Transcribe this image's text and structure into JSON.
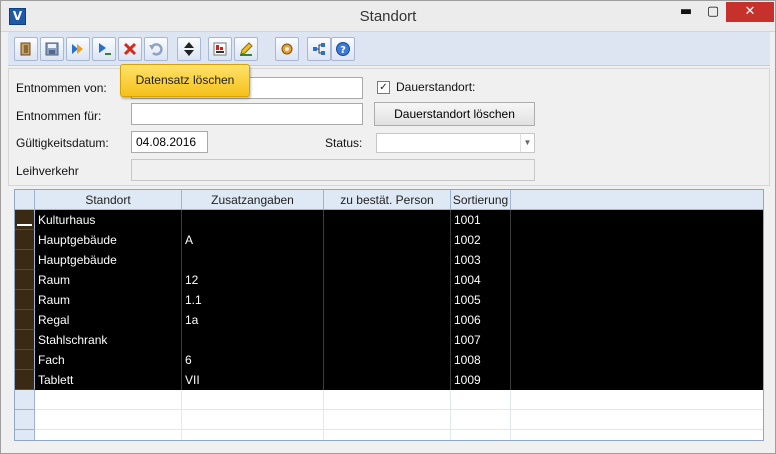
{
  "window": {
    "title": "Standort",
    "minimize": "▬",
    "maximize": "▢",
    "close": "✕"
  },
  "toolbar": {
    "buttons": [
      "exit-icon",
      "save-icon",
      "next-record-icon",
      "last-record-icon",
      "delete-icon",
      "undo-icon",
      "move-up-down-icon",
      "report-icon",
      "edit-icon",
      "settings-icon",
      "tree-icon",
      "help-icon"
    ]
  },
  "tooltip": {
    "text": "Datensatz löschen"
  },
  "form": {
    "entnommen_von_label": "Entnommen von:",
    "entnommen_von_value": "",
    "entnommen_fuer_label": "Entnommen für:",
    "entnommen_fuer_value": "",
    "dauerstandort_label": "Dauerstandort:",
    "dauerstandort_checked": true,
    "dauerstandort_loeschen": "Dauerstandort löschen",
    "gueltigkeitsdatum_label": "Gültigkeitsdatum:",
    "gueltigkeitsdatum_value": "04.08.2016",
    "status_label": "Status:",
    "status_value": "",
    "leihverkehr_label": "Leihverkehr",
    "leihverkehr_value": ""
  },
  "grid": {
    "columns": [
      "Standort",
      "Zusatzangaben",
      "zu bestät. Person",
      "Sortierung"
    ],
    "rows": [
      {
        "standort": "Kulturhaus",
        "zusatz": "",
        "person": "",
        "sort": "1001"
      },
      {
        "standort": "Hauptgebäude",
        "zusatz": "A",
        "person": "",
        "sort": "1002"
      },
      {
        "standort": "Hauptgebäude",
        "zusatz": "",
        "person": "",
        "sort": "1003"
      },
      {
        "standort": "Raum",
        "zusatz": "12",
        "person": "",
        "sort": "1004"
      },
      {
        "standort": "Raum",
        "zusatz": "1.1",
        "person": "",
        "sort": "1005"
      },
      {
        "standort": "Regal",
        "zusatz": "1a",
        "person": "",
        "sort": "1006"
      },
      {
        "standort": "Stahlschrank",
        "zusatz": "",
        "person": "",
        "sort": "1007"
      },
      {
        "standort": "Fach",
        "zusatz": "6",
        "person": "",
        "sort": "1008"
      },
      {
        "standort": "Tablett",
        "zusatz": "VII",
        "person": "",
        "sort": "1009"
      }
    ]
  },
  "colors": {
    "toolbar_bg": "#dde5f2",
    "tooltip": "#f5c21a",
    "close_button": "#c7312c",
    "row_bg": "#000000"
  }
}
